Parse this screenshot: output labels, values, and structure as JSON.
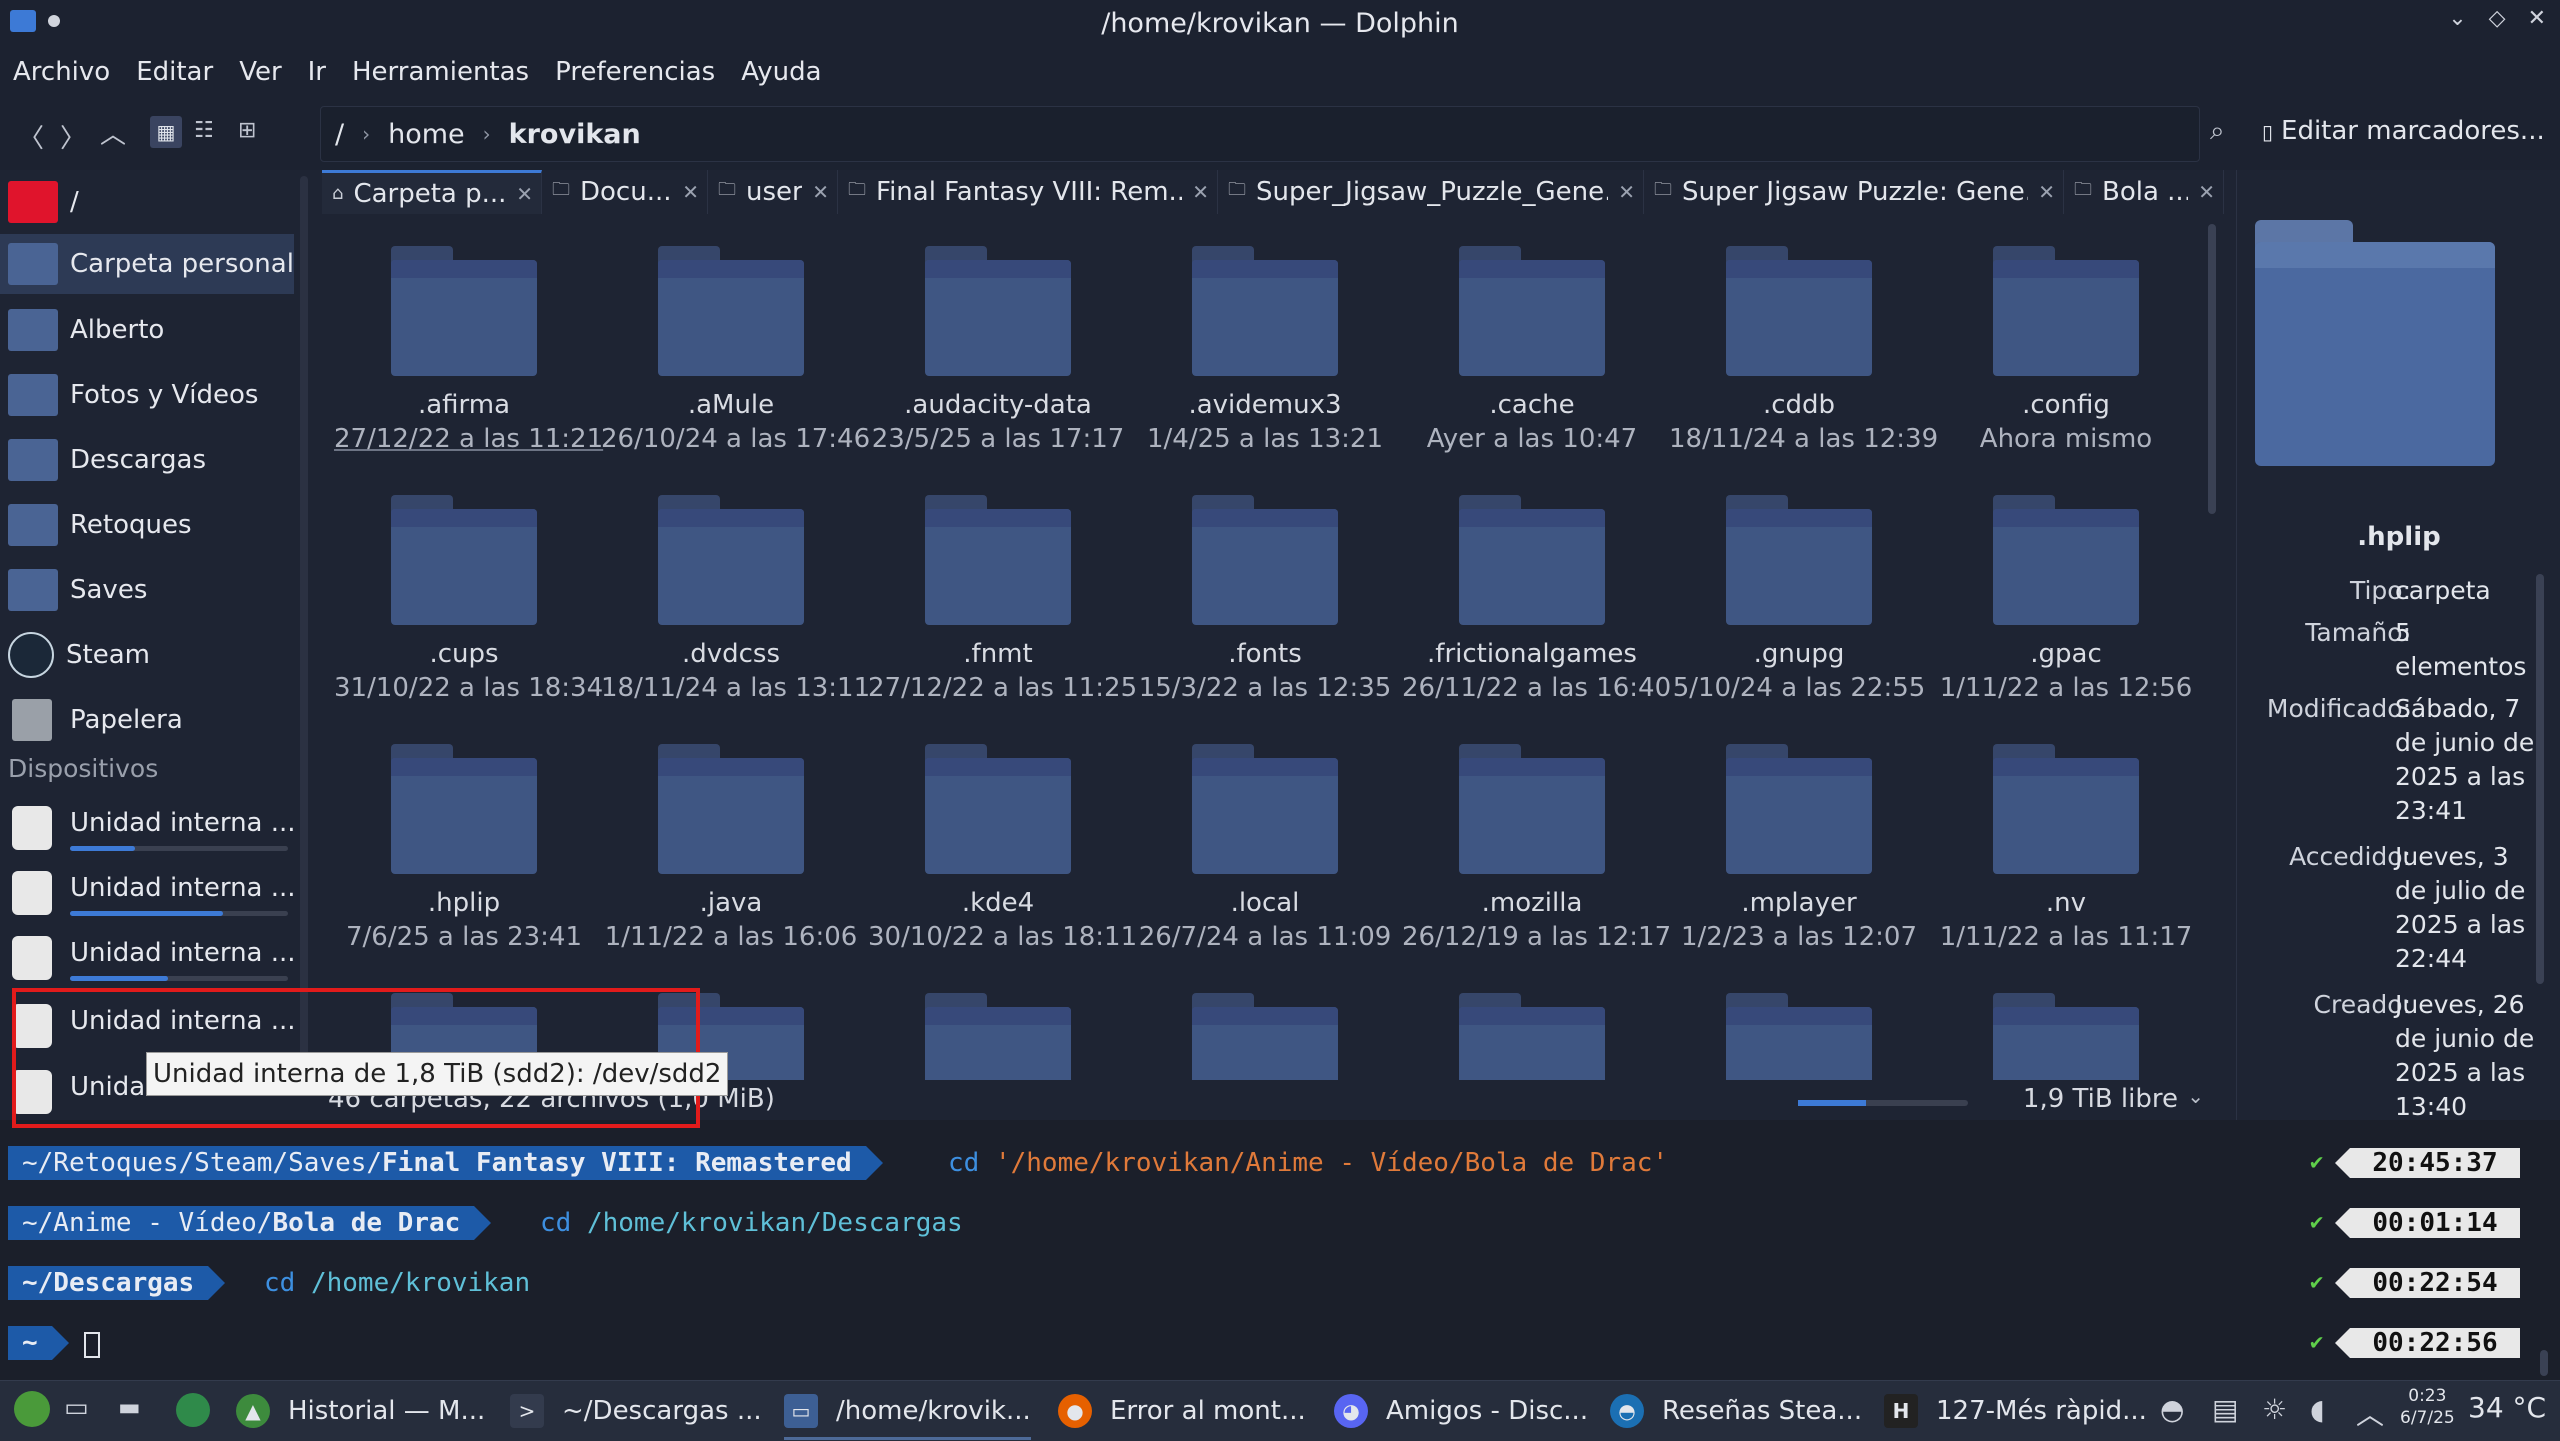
{
  "window": {
    "title": "/home/krovikan — Dolphin",
    "controls": [
      "⌄",
      "◇",
      "✕"
    ]
  },
  "menu": [
    "Archivo",
    "Editar",
    "Ver",
    "Ir",
    "Herramientas",
    "Preferencias",
    "Ayuda"
  ],
  "toolbar": {
    "breadcrumb": [
      "/",
      "home",
      "krovikan"
    ],
    "bookmarks_label": "Editar marcadores..."
  },
  "sidebar": {
    "places": [
      {
        "label": "/",
        "icon": "root-drive-icon"
      },
      {
        "label": "Carpeta personal",
        "icon": "home-folder-icon"
      },
      {
        "label": "Alberto",
        "icon": "folder-icon"
      },
      {
        "label": "Fotos y Vídeos",
        "icon": "folder-icon"
      },
      {
        "label": "Descargas",
        "icon": "downloads-folder-icon"
      },
      {
        "label": "Retoques",
        "icon": "folder-icon"
      },
      {
        "label": "Saves",
        "icon": "folder-icon"
      },
      {
        "label": "Steam",
        "icon": "steam-icon"
      },
      {
        "label": "Papelera",
        "icon": "trash-icon"
      }
    ],
    "devices_header": "Dispositivos",
    "devices": [
      {
        "label": "Unidad interna ...",
        "usage": 0.3
      },
      {
        "label": "Unidad interna ...",
        "usage": 0.7
      },
      {
        "label": "Unidad interna ...",
        "usage": 0.45
      },
      {
        "label": "Unidad interna ...",
        "usage": 0
      },
      {
        "label": "Unidad",
        "usage": 0
      }
    ]
  },
  "tabs": [
    {
      "label": "Carpeta p...",
      "icon": "⌂"
    },
    {
      "label": "Docu...",
      "icon": "🗀"
    },
    {
      "label": "user",
      "icon": "🗀"
    },
    {
      "label": "Final Fantasy VIII: Rem...",
      "icon": "🗀"
    },
    {
      "label": "Super_Jigsaw_Puzzle_Gene...",
      "icon": "🗀"
    },
    {
      "label": "Super Jigsaw Puzzle: Gene...",
      "icon": "🗀"
    },
    {
      "label": "Bola ...",
      "icon": "🗀"
    }
  ],
  "files": [
    {
      "name": ".afirma",
      "date": "27/12/22 a las 11:21"
    },
    {
      "name": ".aMule",
      "date": "26/10/24 a las 17:46"
    },
    {
      "name": ".audacity-data",
      "date": "23/5/25 a las 17:17"
    },
    {
      "name": ".avidemux3",
      "date": "1/4/25 a las 13:21"
    },
    {
      "name": ".cache",
      "date": "Ayer a las 10:47"
    },
    {
      "name": ".cddb",
      "date": "18/11/24 a las 12:39"
    },
    {
      "name": ".config",
      "date": "Ahora mismo"
    },
    {
      "name": ".cups",
      "date": "31/10/22 a las 18:34"
    },
    {
      "name": ".dvdcss",
      "date": "18/11/24 a las 13:11"
    },
    {
      "name": ".fnmt",
      "date": "27/12/22 a las 11:25"
    },
    {
      "name": ".fonts",
      "date": "15/3/22 a las 12:35"
    },
    {
      "name": ".frictionalgames",
      "date": "26/11/22 a las 16:40"
    },
    {
      "name": ".gnupg",
      "date": "5/10/24 a las 22:55"
    },
    {
      "name": ".gpac",
      "date": "1/11/22 a las 12:56"
    },
    {
      "name": ".hplip",
      "date": "7/6/25 a las 23:41"
    },
    {
      "name": ".java",
      "date": "1/11/22 a las 16:06"
    },
    {
      "name": ".kde4",
      "date": "30/10/22 a las 18:11"
    },
    {
      "name": ".local",
      "date": "26/7/24 a las 11:09"
    },
    {
      "name": ".mozilla",
      "date": "26/12/19 a las 12:17"
    },
    {
      "name": ".mplayer",
      "date": "1/2/23 a las 12:07"
    },
    {
      "name": ".nv",
      "date": "1/11/22 a las 11:17"
    }
  ],
  "status": {
    "summary": "46 carpetas, 22 archivos (1,0 MiB)",
    "free": "1,9 TiB libre",
    "free_fraction": 0.4
  },
  "info_panel": {
    "name": ".hplip",
    "rows": [
      {
        "key": "Tipo:",
        "value": "carpeta"
      },
      {
        "key": "Tamaño:",
        "value": "5 elementos"
      },
      {
        "key": "Modificado:",
        "value": "Sábado, 7 de junio de 2025 a las 23:41"
      },
      {
        "key": "Accedido:",
        "value": "Jueves, 3 de julio de 2025 a las 22:44"
      },
      {
        "key": "Creado:",
        "value": "Jueves, 26 de junio de 2025 a las 13:40"
      }
    ]
  },
  "terminal": [
    {
      "path_prefix": "~/Retoques/Steam/Saves/",
      "path_bold": "Final Fantasy VIII: Remastered",
      "cmd": "cd",
      "arg": "'/home/krovikan/Anime - Vídeo/Bola de Drac'",
      "time": "20:45:37"
    },
    {
      "path_prefix": "~/Anime - Vídeo/",
      "path_bold": "Bola de Drac",
      "cmd": "cd",
      "arg": "/home/krovikan/Descargas",
      "time": "00:01:14"
    },
    {
      "path_prefix": "",
      "path_bold": "~/Descargas",
      "cmd": "cd",
      "arg": "/home/krovikan",
      "time": "00:22:54"
    },
    {
      "path_prefix": "",
      "path_bold": "~",
      "cmd": "",
      "arg": "",
      "time": "00:22:56"
    }
  ],
  "tooltip": "Unidad interna de 1,8 TiB (sdd2): /dev/sdd2",
  "taskbar": {
    "tasks": [
      {
        "label": "Historial — M...",
        "color": "#3d8b3d"
      },
      {
        "label": "~/Descargas ...",
        "color": "#333b4d"
      },
      {
        "label": "/home/krovik...",
        "color": "#3d5f94"
      },
      {
        "label": "Error al mont...",
        "color": "#e66000"
      },
      {
        "label": "Amigos - Disc...",
        "color": "#5865f2"
      },
      {
        "label": "Reseñas Stea...",
        "color": "#1b6fb3"
      },
      {
        "label": "127-Més ràpid...",
        "color": "#222222"
      }
    ],
    "clock_time": "0:23",
    "clock_date": "6/7/25",
    "temperature": "34 °C"
  }
}
